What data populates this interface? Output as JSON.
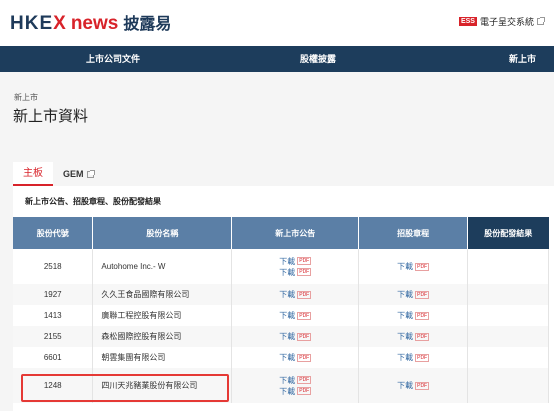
{
  "header": {
    "logo_hkex": "HKE",
    "logo_x": "X",
    "logo_news": "news",
    "logo_cn": "披露易",
    "ess_badge": "ESS",
    "ess_label": "電子呈交系統"
  },
  "nav": {
    "items": [
      "上市公司文件",
      "股權披露",
      "新上市"
    ]
  },
  "breadcrumb": "新上市",
  "page_title": "新上市資料",
  "tabs": [
    {
      "label": "主板",
      "active": true
    },
    {
      "label": "GEM",
      "active": false
    }
  ],
  "subheading": "新上市公告、招股章程、股份配發結果",
  "table": {
    "headers": [
      "股份代號",
      "股份名稱",
      "新上市公告",
      "招股章程",
      "股份配發結果"
    ],
    "download_label": "下載",
    "pdf_label": "PDF",
    "rows": [
      {
        "code": "2518",
        "name": "Autohome Inc.- W",
        "ann_links": 2,
        "prospectus_links": 1
      },
      {
        "code": "1927",
        "name": "久久王食品國際有限公司",
        "ann_links": 1,
        "prospectus_links": 1
      },
      {
        "code": "1413",
        "name": "廣聯工程控股有限公司",
        "ann_links": 1,
        "prospectus_links": 1
      },
      {
        "code": "2155",
        "name": "森松國際控股有限公司",
        "ann_links": 1,
        "prospectus_links": 1
      },
      {
        "code": "6601",
        "name": "朝雲集團有限公司",
        "ann_links": 1,
        "prospectus_links": 1
      },
      {
        "code": "1248",
        "name": "四川天兆豬業股份有限公司",
        "ann_links": 2,
        "prospectus_links": 1
      }
    ]
  },
  "colors": {
    "brand_red": "#d8232a",
    "nav_blue": "#1d3d5c",
    "header_blue": "#5b7fa6",
    "highlight": "#e53935"
  }
}
